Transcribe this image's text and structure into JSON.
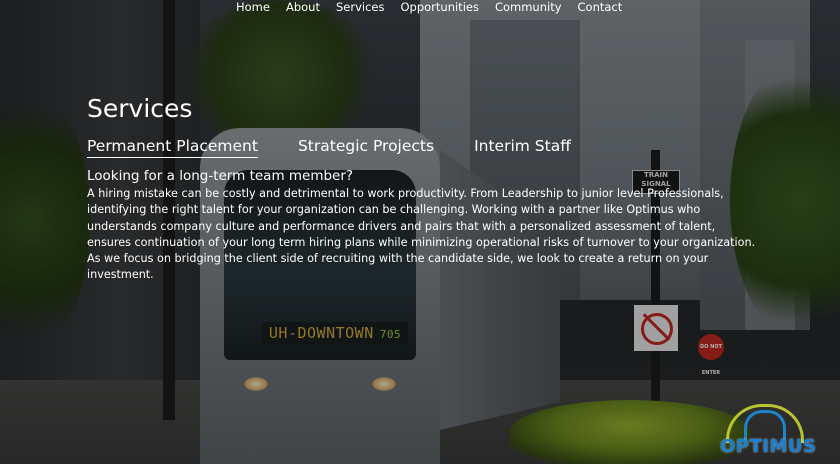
{
  "nav": {
    "items": [
      "Home",
      "About",
      "Services",
      "Opportunities",
      "Community",
      "Contact"
    ]
  },
  "page": {
    "title": "Services"
  },
  "tabs": [
    {
      "label": "Permanent Placement",
      "active": true
    },
    {
      "label": "Strategic Projects",
      "active": false
    },
    {
      "label": "Interim Staff",
      "active": false
    }
  ],
  "content": {
    "heading": "Looking for a long-term team member?",
    "body": "A hiring mistake can be costly and detrimental to work productivity. From Leadership to junior level Professionals, identifying the right talent for your organization can be challenging. Working with a partner like Optimus who understands company culture and performance drivers and pairs that with a personalized assessment of talent, ensures continuation of your long term hiring plans while minimizing operational risks of turnover to your organization. As we focus on bridging the client side of recruiting with the candidate side, we look to create a return on your investment."
  },
  "background": {
    "tram_destination": "UH-DOWNTOWN",
    "tram_number": "705",
    "sign_train": "TRAIN SIGNAL",
    "sign_no_entry": "DO NOT ENTER"
  },
  "logo": {
    "text": "OPTIMUS"
  },
  "colors": {
    "text": "#ffffff",
    "logo_blue": "#1a7fd0",
    "logo_lime": "#c7d531"
  }
}
